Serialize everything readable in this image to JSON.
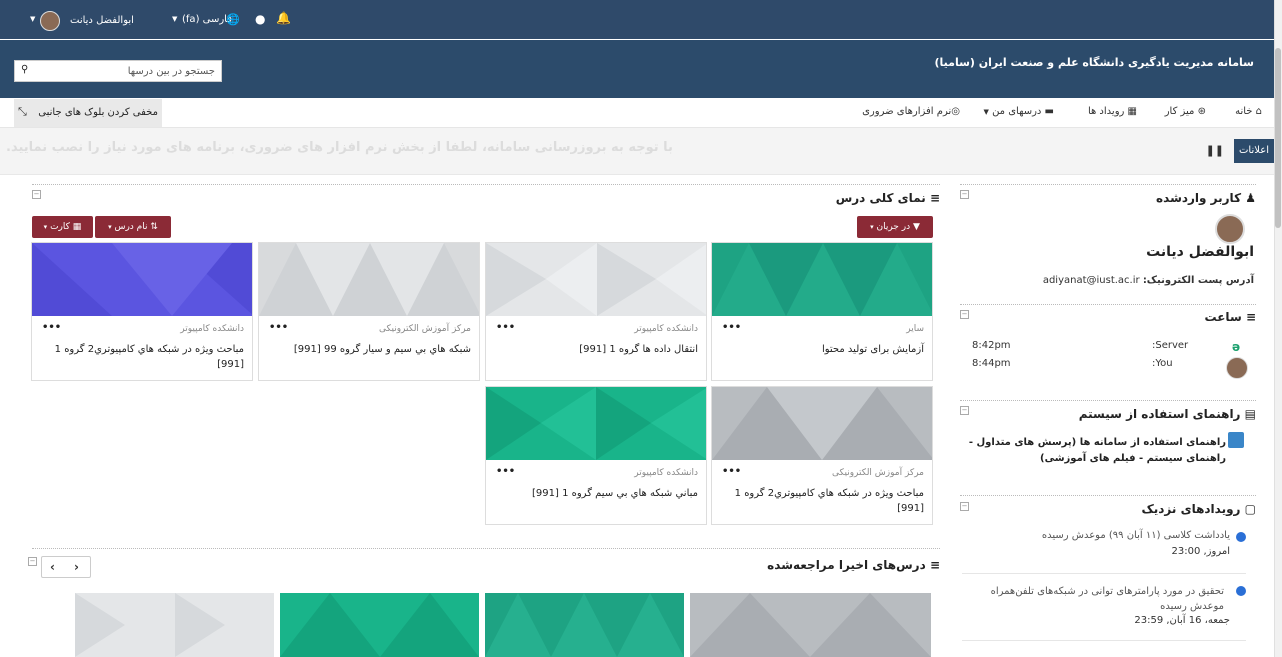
{
  "topbar": {
    "user_name": "ابوالفضل دیانت",
    "language": "فارسی (fa)"
  },
  "header": {
    "site_title": "سامانه مدیریت یادگیری دانشگاه علم و صنعت ایران (سامیا)",
    "search_placeholder": "جستجو در بین درسها"
  },
  "nav": {
    "home": "خانه",
    "dashboard": "میز کار",
    "events": "رویداد ها",
    "my_courses": "درسهای من",
    "software": "نرم افزارهای ضروری",
    "hide_blocks": "مخفی کردن بلوک های جانبی"
  },
  "ticker": {
    "label": "اعلانات",
    "text": "با توجه به بروزرسانی سامانه، لطفا از بخش نرم افزار های ضروری، برنامه های مورد نیاز را نصب نمایید."
  },
  "overview": {
    "title": "نمای کلی درس",
    "filter_button": "در جریان",
    "sort_button": "نام درس",
    "view_button": "کارت",
    "cards": [
      {
        "category": "سایر",
        "name": "آزمایش برای تولید محتوا",
        "color": "#1ea383"
      },
      {
        "category": "دانشکده کامپیوتر",
        "name": "انتقال داده ها گروه 1 [991]",
        "color": "#e4e6e8"
      },
      {
        "category": "مرکز آموزش الکترونیکی",
        "name": "شبکه هاي بي سيم و سيار گروه 99 [991]",
        "color": "#d8dadc"
      },
      {
        "category": "دانشکده کامپیوتر",
        "name": "مباحث ويژه در شبكه هاي كامپيوتري2 گروه 1 [991]",
        "color": "#5b55e0"
      },
      {
        "category": "مرکز آموزش الکترونیکی",
        "name": "مباحث ويژه در شبكه هاي كامپيوتري2 گروه 1 [991]",
        "color": "#b8bcc0"
      },
      {
        "category": "دانشکده کامپیوتر",
        "name": "مباني شبكه هاي بي سيم گروه 1 [991]",
        "color": "#19b48a"
      }
    ]
  },
  "recent": {
    "title": "درس‌های اخیرا مراجعه‌شده"
  },
  "sidebar": {
    "logged_in_title": "کاربر واردشده",
    "user_name": "ابوالفضل دیانت",
    "email_label": "آدرس پست الکترونیک:",
    "email": "adiyanat@iust.ac.ir",
    "clock_title": "ساعت",
    "server_label": "Server:",
    "server_time": "8:42pm",
    "you_label": "You:",
    "you_time": "8:44pm",
    "guide_title": "راهنمای استفاده از سیستم",
    "guide_link": "راهنمای استفاده از سامانه ها (پرسش های متداول - راهنمای سیستم - فیلم های آموزشی)",
    "events_title": "رویدادهای نزدیک",
    "events": [
      {
        "title": "يادداشت كلاسی (۱۱ آبان ۹۹) موعدش رسیده",
        "time": "امروز, 23:00"
      },
      {
        "title": "تحقیق در مورد پارامترهای توانی در شبکه‌های تلفن‌همراه موعدش رسیده",
        "time": "جمعه، 16 آبان, 23:59"
      }
    ]
  }
}
